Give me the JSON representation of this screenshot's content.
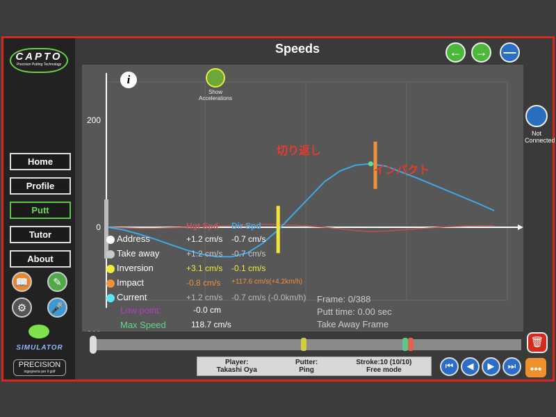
{
  "sidebar": {
    "logo": "CAPTO",
    "logo_tagline": "Precision Putting Technology",
    "nav": [
      {
        "label": "Home"
      },
      {
        "label": "Profile"
      },
      {
        "label": "Putt",
        "active": true
      },
      {
        "label": "Tutor"
      },
      {
        "label": "About"
      }
    ],
    "icons": [
      "book-icon",
      "notes-icon",
      "gear-icon",
      "microphone-record-icon"
    ],
    "simulator_label": "SIMULATOR",
    "precision_logo": "PRECISION",
    "precision_tagline": "ingegneria per il golf"
  },
  "header": {
    "title": "Speeds"
  },
  "chart_controls": {
    "info": "i",
    "show_accelerations": "Show Accelerations"
  },
  "status": {
    "label": "Not Connected"
  },
  "annotations": {
    "inversion": "切り返し",
    "impact": "インパクト"
  },
  "chart_data": {
    "type": "line",
    "ylim": [
      -200,
      200
    ],
    "yticks": [
      "200",
      "0",
      "-200"
    ],
    "grid": true,
    "series": [
      {
        "name": "Hgt Spd",
        "color": "#c0504d",
        "values": [
          0,
          -1,
          -2,
          -2,
          -1,
          0,
          1,
          2,
          3,
          4,
          5,
          5,
          4,
          2,
          0,
          -3,
          -6,
          -8,
          -7,
          -5,
          -3,
          -1,
          1,
          2,
          3,
          3
        ]
      },
      {
        "name": "Dir Spd",
        "color": "#3fa9e6",
        "values": [
          0,
          -5,
          -13,
          -22,
          -32,
          -42,
          -50,
          -55,
          -55,
          -48,
          -30,
          -5,
          25,
          55,
          85,
          105,
          116,
          118.7,
          114,
          103,
          92,
          80,
          68,
          56,
          44,
          31
        ]
      }
    ],
    "markers": [
      {
        "name": "Inversion",
        "color": "#f2e63a",
        "at": 11
      },
      {
        "name": "Impact",
        "color": "#f0903a",
        "at": 17.3
      }
    ],
    "max_point": {
      "value": 118.7,
      "color": "#5fe08a"
    }
  },
  "stats": {
    "headers": {
      "hgt": "Hgt Spd",
      "dir": "Dir Spd"
    },
    "rows": [
      {
        "label": "Address",
        "color": "#ffffff",
        "hgt": "+1.2 cm/s",
        "dir": "-0.7 cm/s",
        "text": "#ffffff"
      },
      {
        "label": "Take away",
        "color": "#c8c8c8",
        "hgt": "+1.2 cm/s",
        "dir": "-0.7 cm/s",
        "text": "#c8c8c8"
      },
      {
        "label": "Inversion",
        "color": "#f2ec3a",
        "hgt": "+3.1 cm/s",
        "dir": "-0.1 cm/s",
        "text": "#f2ec3a"
      },
      {
        "label": "Impact",
        "color": "#f0903a",
        "hgt": "-0.8 cm/s",
        "dir": "+117.6 cm/s(+4.2km/h)",
        "text": "#f0903a"
      },
      {
        "label": "Current",
        "color": "#5ee6f0",
        "hgt": "+1.2 cm/s",
        "dir": "-0.7 cm/s  (-0.0km/h)",
        "text": "#bbbbbb"
      }
    ],
    "low_point_label": "Low point:",
    "low_point": "-0.0 cm",
    "max_speed_label": "Max Speed",
    "max_speed": "118.7 cm/s"
  },
  "frame_info": {
    "frame": "Frame: 0/388",
    "putt_time": "Putt time: 0.00 sec",
    "mode": "Take Away Frame"
  },
  "timeline": {
    "current": 0,
    "total": 388,
    "markers": [
      {
        "frame": 191,
        "color": "#d4cc3a"
      },
      {
        "frame": 283,
        "color": "#5cc98a"
      },
      {
        "frame": 288,
        "color": "#e0644a"
      }
    ]
  },
  "footer": {
    "player_label": "Player:",
    "player": "Takashi Oya",
    "putter_label": "Putter:",
    "putter": "Ping",
    "stroke_label": "Stroke:10 (10/10)",
    "mode": "Free mode"
  }
}
